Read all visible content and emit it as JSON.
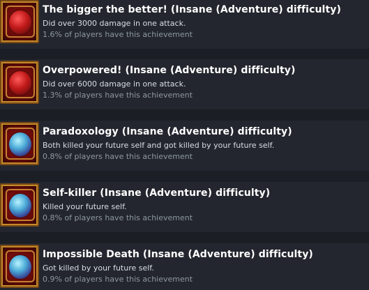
{
  "achievements": [
    {
      "title": "The bigger the better! (Insane (Adventure) difficulty)",
      "description": "Did over 3000 damage in one attack.",
      "percent": "1.6% of players have this achievement",
      "icon": "red-orb-achievement-icon"
    },
    {
      "title": "Overpowered! (Insane (Adventure) difficulty)",
      "description": "Did over 6000 damage in one attack.",
      "percent": "1.3% of players have this achievement",
      "icon": "red-orb-achievement-icon"
    },
    {
      "title": "Paradoxology (Insane (Adventure) difficulty)",
      "description": "Both killed your future self and got killed by your future self.",
      "percent": "0.8% of players have this achievement",
      "icon": "blue-orb-achievement-icon"
    },
    {
      "title": "Self-killer (Insane (Adventure) difficulty)",
      "description": "Killed your future self.",
      "percent": "0.8% of players have this achievement",
      "icon": "blue-orb-achievement-icon"
    },
    {
      "title": "Impossible Death (Insane (Adventure) difficulty)",
      "description": "Got killed by your future self.",
      "percent": "0.9% of players have this achievement",
      "icon": "blue-orb-achievement-icon"
    }
  ],
  "colors": {
    "background": "#1b1e24",
    "row": "#23262e",
    "title": "#ffffff",
    "description": "#d9dde3",
    "percent": "#8f98a0"
  }
}
